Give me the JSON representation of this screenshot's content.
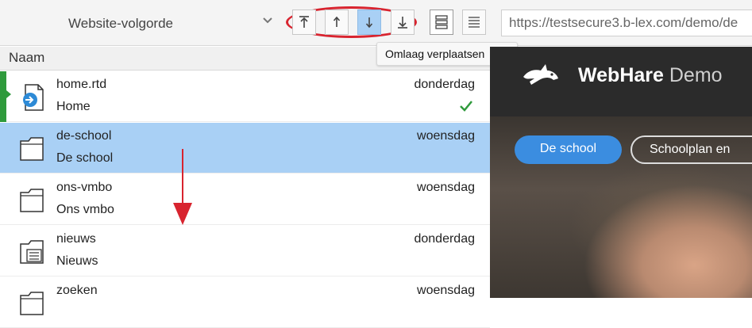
{
  "toolbar": {
    "sort_select": {
      "value": "Website-volgorde"
    },
    "move_buttons": [
      {
        "name": "move-to-top",
        "active": false
      },
      {
        "name": "move-up",
        "active": false
      },
      {
        "name": "move-down",
        "active": true
      },
      {
        "name": "move-to-bottom",
        "active": false
      }
    ],
    "url": "https://testsecure3.b-lex.com/demo/de"
  },
  "list": {
    "column_header": "Naam",
    "tooltip": "Omlaag verplaatsen",
    "rows": [
      {
        "name": "home.rtd",
        "title": "Home",
        "date": "donderdag",
        "icon": "rtd-document-icon",
        "published": true,
        "current": true,
        "selected": false
      },
      {
        "name": "de-school",
        "title": "De school",
        "date": "woensdag",
        "icon": "folder-icon",
        "selected": true
      },
      {
        "name": "ons-vmbo",
        "title": "Ons vmbo",
        "date": "woensdag",
        "icon": "folder-icon",
        "selected": false
      },
      {
        "name": "nieuws",
        "title": "Nieuws",
        "date": "donderdag",
        "icon": "news-folder-icon",
        "selected": false
      },
      {
        "name": "zoeken",
        "title": "",
        "date": "woensdag",
        "icon": "folder-icon",
        "selected": false
      }
    ]
  },
  "preview": {
    "brand_bold": "WebHare",
    "brand_light": "Demo",
    "nav": [
      "De school",
      "Schoolplan en"
    ]
  },
  "colors": {
    "selection": "#a9d0f5",
    "annotation_red": "#d8242f",
    "status_green": "#2f9a3c",
    "nav_blue": "#3b8de0"
  }
}
